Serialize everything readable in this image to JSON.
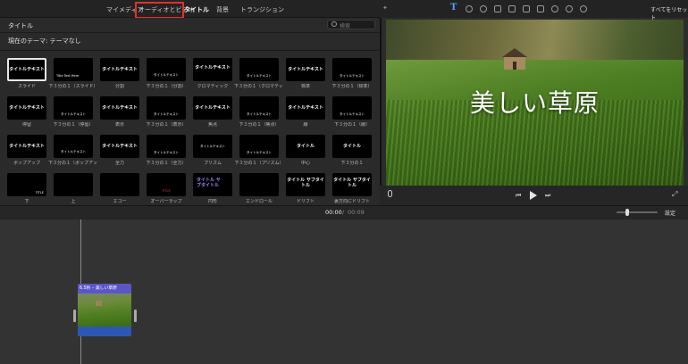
{
  "top_tabs": [
    {
      "label": "マイメディア"
    },
    {
      "label": "オーディオとビデオ"
    },
    {
      "label": "タイトル"
    },
    {
      "label": "背景"
    },
    {
      "label": "トランジション"
    }
  ],
  "browser": {
    "title": "タイトル",
    "search_placeholder": "検索",
    "theme_label": "現在のテーマ: テーマなし"
  },
  "tiles": [
    {
      "preview": "タイトルテキスト",
      "caption": "スライド"
    },
    {
      "preview": "Title Text Here",
      "caption": "下３分の１（スライド）"
    },
    {
      "preview": "タイトルテキスト",
      "caption": "分割"
    },
    {
      "preview": "タイトルテキスト",
      "caption": "下３分の１（分割）"
    },
    {
      "preview": "タイトルテキスト",
      "caption": "クロマティック"
    },
    {
      "preview": "タイトルテキスト",
      "caption": "下３分の１（クロマティック）"
    },
    {
      "preview": "タイトルテキスト",
      "caption": "標準"
    },
    {
      "preview": "タイトルテキスト",
      "caption": "下３分の１（標準）"
    },
    {
      "preview": "タイトルテキスト",
      "caption": "停留"
    },
    {
      "preview": "タイトルテキスト",
      "caption": "下３分の１（停留）"
    },
    {
      "preview": "タイトルテキスト",
      "caption": "表示"
    },
    {
      "preview": "タイトルテキスト",
      "caption": "下３分の１（表示）"
    },
    {
      "preview": "タイトルテキスト",
      "caption": "焦点"
    },
    {
      "preview": "タイトルテキスト",
      "caption": "下３分の１（焦点）"
    },
    {
      "preview": "タイトルテキスト",
      "caption": "線"
    },
    {
      "preview": "タイトルテキスト",
      "caption": "下３分の１（線）"
    },
    {
      "preview": "タイトルテキスト",
      "caption": "ポップアップ"
    },
    {
      "preview": "タイトルテキスト",
      "caption": "下３分の１（ポップアップ）"
    },
    {
      "preview": "タイトルテキスト",
      "caption": "全力"
    },
    {
      "preview": "タイトルテキスト",
      "caption": "下３分の１（全力）"
    },
    {
      "preview": "タイトルテキスト",
      "caption": "プリズム"
    },
    {
      "preview": "タイトルテキスト",
      "caption": "下３分の１（プリズム）"
    },
    {
      "preview": "タイトル",
      "caption": "中心"
    },
    {
      "preview": "タイトル",
      "caption": "下３分の１"
    },
    {
      "preview": "TITLE",
      "caption": "下"
    },
    {
      "preview": "",
      "caption": "上"
    },
    {
      "preview": "",
      "caption": "エコー"
    },
    {
      "preview": "TITLE",
      "caption": "オーバーラップ"
    },
    {
      "preview": "タイトル サブタイトル",
      "caption": "円形"
    },
    {
      "preview": "",
      "caption": "エンドロール"
    },
    {
      "preview": "タイトル サブタイトル",
      "caption": "ドリフト"
    },
    {
      "preview": "タイトル サブタイトル",
      "caption": "裏方向にドリフト"
    }
  ],
  "viewer": {
    "reset_all": "すべてをリセット",
    "overlay_title": "美しい草原",
    "toolbar_icons": [
      "title-icon",
      "color-balance-icon",
      "color-correction-icon",
      "crop-icon",
      "stabilization-icon",
      "volume-icon",
      "equalizer-icon",
      "speed-icon",
      "noise-reduction-icon",
      "info-icon"
    ]
  },
  "timeline": {
    "current_time": "00:00",
    "separator": "/",
    "total_time": "00:09",
    "settings_label": "設定",
    "clip_title": "6.5秒 – 美しい草原"
  },
  "colors": {
    "highlight": "#e0322b",
    "accent_blue": "#4aa3ff",
    "clip_title_bar": "#5b56c8",
    "clip_audio": "#2c58b4"
  }
}
